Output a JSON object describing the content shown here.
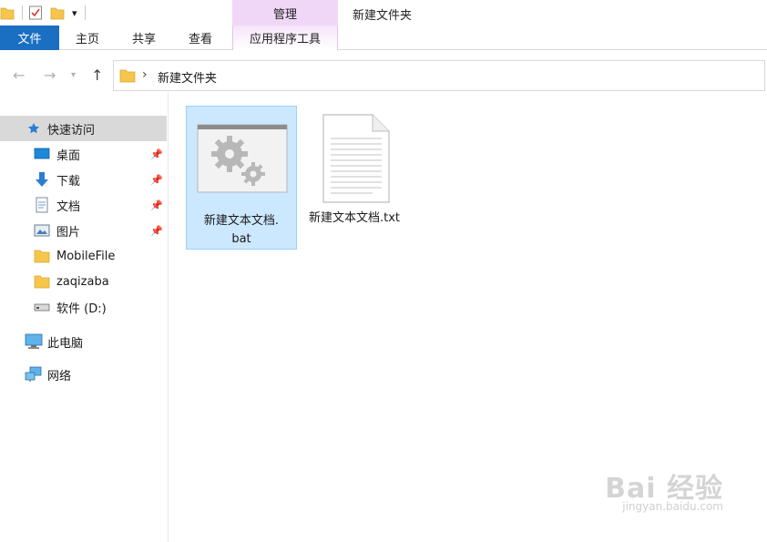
{
  "titlebar": {
    "contextual_header": "管理",
    "title": "新建文件夹"
  },
  "ribbon": {
    "tabs": [
      "文件",
      "主页",
      "共享",
      "查看",
      "应用程序工具"
    ]
  },
  "address": {
    "path": "新建文件夹"
  },
  "sidebar": {
    "quick_access": "快速访问",
    "items": [
      {
        "label": "桌面",
        "icon": "desktop-icon",
        "pinned": true
      },
      {
        "label": "下载",
        "icon": "download-icon",
        "pinned": true
      },
      {
        "label": "文档",
        "icon": "documents-icon",
        "pinned": true
      },
      {
        "label": "图片",
        "icon": "pictures-icon",
        "pinned": true
      },
      {
        "label": "MobileFile",
        "icon": "folder-icon",
        "pinned": false
      },
      {
        "label": "zaqizaba",
        "icon": "folder-icon",
        "pinned": false
      },
      {
        "label": "软件 (D:)",
        "icon": "drive-icon",
        "pinned": false
      }
    ],
    "this_pc": "此电脑",
    "network": "网络"
  },
  "files": [
    {
      "name_line1": "新建文本文档.",
      "name_line2": "bat",
      "icon": "batch-file-icon",
      "selected": true
    },
    {
      "name_line1": "新建文本文档.txt",
      "name_line2": "",
      "icon": "text-file-icon",
      "selected": false
    }
  ],
  "watermark": {
    "main": "Bai 经验",
    "sub": "jingyan.baidu.com"
  },
  "colors": {
    "file_tab": "#1a6fc2",
    "contextual": "#f1d7f7",
    "selection": "#cce8ff",
    "sidebar_selected": "#d9d9d9"
  }
}
